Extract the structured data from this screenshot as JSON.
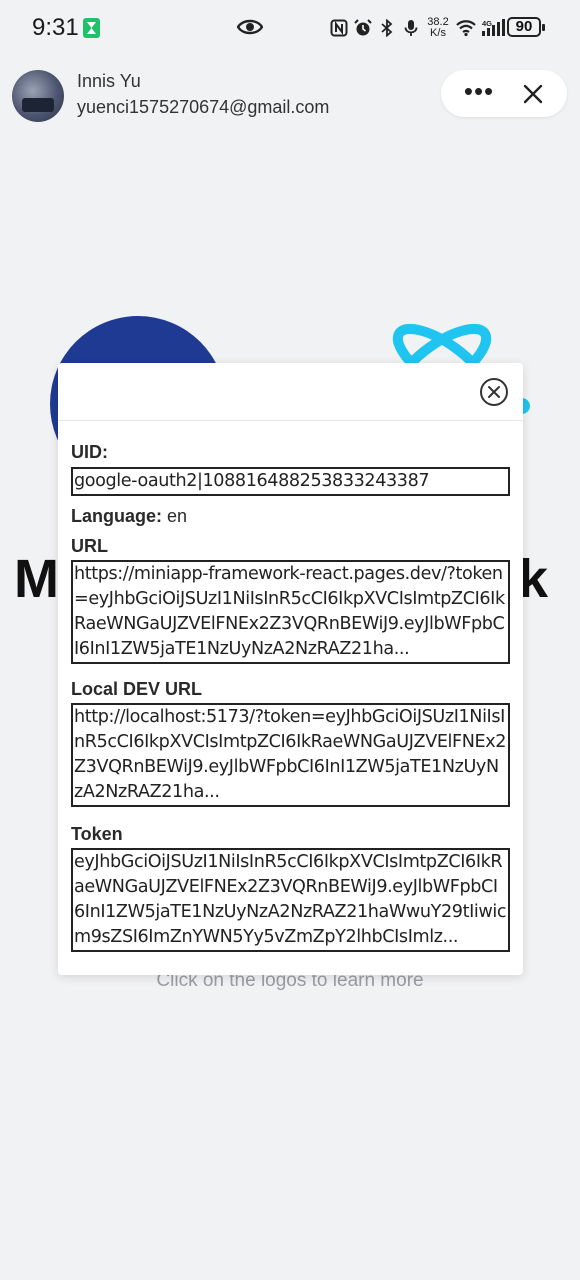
{
  "status_bar": {
    "time": "9:31",
    "net_speed_value": "38.2",
    "net_speed_unit": "K/s",
    "battery": "90",
    "icons": [
      "hourglass-icon",
      "eye-icon",
      "nfc-icon",
      "alarm-icon",
      "bluetooth-icon",
      "mic-icon",
      "wifi-icon",
      "signal-4g-icon",
      "battery-icon"
    ]
  },
  "header": {
    "user_name": "Innis Yu",
    "user_email": "yuenci1575270674@gmail.com",
    "more_label": "•••"
  },
  "background_page": {
    "title_left": "M",
    "title_right": "k",
    "hint": "Click on the logos to learn more",
    "colors": {
      "left_logo": "#1f3a93",
      "react_logo": "#1fc5f0"
    }
  },
  "modal": {
    "uid_label": "UID:",
    "uid_value": "google-oauth2|108816488253833243387",
    "language_label": "Language:",
    "language_value": "en",
    "url_label": "URL",
    "url_value": "https://miniapp-framework-react.pages.dev/?token=eyJhbGciOiJSUzI1NiIsInR5cCI6IkpXVCIsImtpZCI6IkRaeWNGaUJZVElFNEx2Z3VQRnBEWiJ9.eyJlbWFpbCI6InI1ZW5jaTE1NzUyNzA2NzRAZ21ha...",
    "dev_url_label": "Local DEV URL",
    "dev_url_value": "http://localhost:5173/?token=eyJhbGciOiJSUzI1NiIsInR5cCI6IkpXVCIsImtpZCI6IkRaeWNGaUJZVElFNEx2Z3VQRnBEWiJ9.eyJlbWFpbCI6InI1ZW5jaTE1NzUyNzA2NzRAZ21ha...",
    "token_label": "Token",
    "token_value": "eyJhbGciOiJSUzI1NiIsInR5cCI6IkpXVCIsImtpZCI6IkRaeWNGaUJZVElFNEx2Z3VQRnBEWiJ9.eyJlbWFpbCI6InI1ZW5jaTE1NzUyNzA2NzRAZ21haWwuY29tIiwicm9sZSI6ImZnYWN5Yy5vZmZpY2lhbCIsImlz..."
  }
}
